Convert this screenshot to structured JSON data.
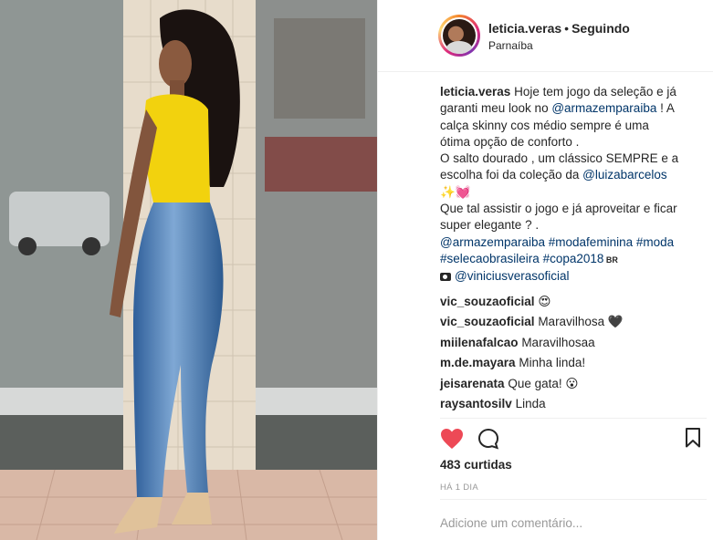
{
  "post": {
    "username": "leticia.veras",
    "separator": "•",
    "follow_status": "Seguindo",
    "location": "Parnaíba"
  },
  "caption": {
    "username": "leticia.veras",
    "l1": " Hoje tem jogo da seleção e já",
    "l2a": "garanti meu look no ",
    "mention1": "@armazemparaiba",
    "l2b": " ! A",
    "l3": "calça skinny cos médio sempre é uma",
    "l4": "ótima opção de conforto .",
    "l5": "O salto dourado , um clássico SEMPRE e a",
    "l6a": "escolha foi da coleção da ",
    "mention2": "@luizabarcelos",
    "l7": "✨💓",
    "l8": "Que tal assistir o jogo e já aproveitar e ficar",
    "l9": "super elegante ? .",
    "tag1": "@armazemparaiba",
    "tag2": "#modafeminina",
    "tag3": "#moda",
    "tag4": "#selecaobrasileira",
    "tag5": "#copa2018",
    "br": " BR",
    "credit": "@viniciusverasoficial"
  },
  "comments": [
    {
      "user": "vic_souzaoficial",
      "text": "😍"
    },
    {
      "user": "vic_souzaoficial",
      "text": "Maravilhosa 🖤"
    },
    {
      "user": "miilenafalcao",
      "text": "Maravilhosaa"
    },
    {
      "user": "m.de.mayara",
      "text": "Minha linda!"
    },
    {
      "user": "jeisarenata",
      "text": "Que gata! 😮"
    },
    {
      "user": "raysantosilv",
      "text": "Linda"
    }
  ],
  "likes": "483 curtidas",
  "time": "HÁ 1 DIA",
  "add_comment_placeholder": "Adicione um comentário...",
  "icons": {
    "like": "heart-icon",
    "comment": "speech-bubble-icon",
    "save": "bookmark-icon",
    "credit": "camera-icon"
  },
  "colors": {
    "like_red": "#ed4956",
    "link_blue": "#003569",
    "muted": "#999999"
  }
}
